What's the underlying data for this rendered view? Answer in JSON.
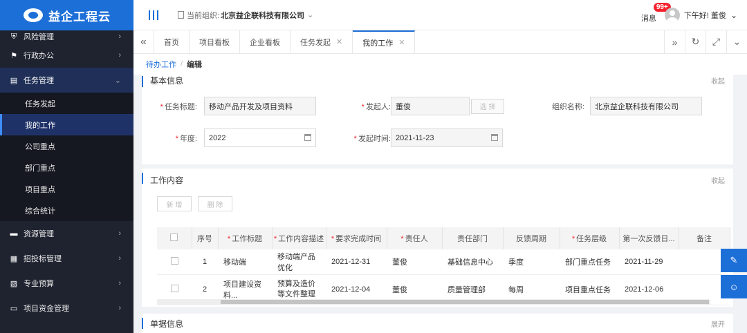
{
  "app": {
    "name": "益企工程云"
  },
  "sidebar": {
    "items": [
      {
        "label": "风险管理",
        "icon": "shield-icon"
      },
      {
        "label": "行政办公",
        "icon": "flag-icon"
      },
      {
        "label": "任务管理",
        "icon": "clipboard-icon",
        "expanded": true
      },
      {
        "label": "资源管理",
        "icon": "folder-icon"
      },
      {
        "label": "招投标管理",
        "icon": "document-icon"
      },
      {
        "label": "专业预算",
        "icon": "file-icon"
      },
      {
        "label": "项目资金管理",
        "icon": "wallet-icon"
      }
    ],
    "submenu": [
      "任务发起",
      "我的工作",
      "公司重点",
      "部门重点",
      "项目重点",
      "综合统计"
    ],
    "current_sub": "我的工作"
  },
  "header": {
    "org_prefix": "当前组织:",
    "org_name": "北京益企联科技有限公司",
    "messages_label": "消息",
    "messages_badge": "99+",
    "greeting": "下午好! 董俊"
  },
  "tabs": [
    {
      "label": "首页",
      "closable": false
    },
    {
      "label": "项目看板",
      "closable": false
    },
    {
      "label": "企业看板",
      "closable": false
    },
    {
      "label": "任务发起",
      "closable": true
    },
    {
      "label": "我的工作",
      "closable": true,
      "active": true
    }
  ],
  "breadcrumb": {
    "parent": "待办工作",
    "separator": "/",
    "current": "编辑"
  },
  "basic_info": {
    "title": "基本信息",
    "fold": "收起",
    "fields": {
      "task_title": {
        "label": "任务标题:",
        "value": "移动产品开发及项目资料"
      },
      "initiator": {
        "label": "发起人:",
        "value": "董俊",
        "button": "选 择"
      },
      "org_name": {
        "label": "组织名称:",
        "value": "北京益企联科技有限公司"
      },
      "year": {
        "label": "年度:",
        "value": "2022"
      },
      "start_time": {
        "label": "发起时间:",
        "value": "2021-11-23"
      }
    }
  },
  "work_content": {
    "title": "工作内容",
    "fold": "收起",
    "add": "新 增",
    "delete": "删 除",
    "columns": [
      "序号",
      "工作标题",
      "工作内容描述",
      "要求完成时间",
      "责任人",
      "责任部门",
      "反馈周期",
      "任务层级",
      "第一次反馈日...",
      "备注"
    ],
    "rows": [
      {
        "no": "1",
        "title": "移动端",
        "desc": "移动端产品优化",
        "due": "2021-12-31",
        "owner": "董俊",
        "dept": "基础信息中心",
        "cycle": "季度",
        "level": "部门重点任务",
        "first": "2021-11-29",
        "note": ""
      },
      {
        "no": "2",
        "title": "项目建设资料...",
        "desc": "预算及造价等文件整理",
        "due": "2021-12-04",
        "owner": "董俊",
        "dept": "质量管理部",
        "cycle": "每周",
        "level": "项目重点任务",
        "first": "2021-12-06",
        "note": ""
      }
    ]
  },
  "doc_info": {
    "title": "单据信息",
    "expand": "展开"
  },
  "colors": {
    "primary": "#1d6fd8",
    "sidebar": "#1f2330",
    "required": "#f5222d"
  }
}
